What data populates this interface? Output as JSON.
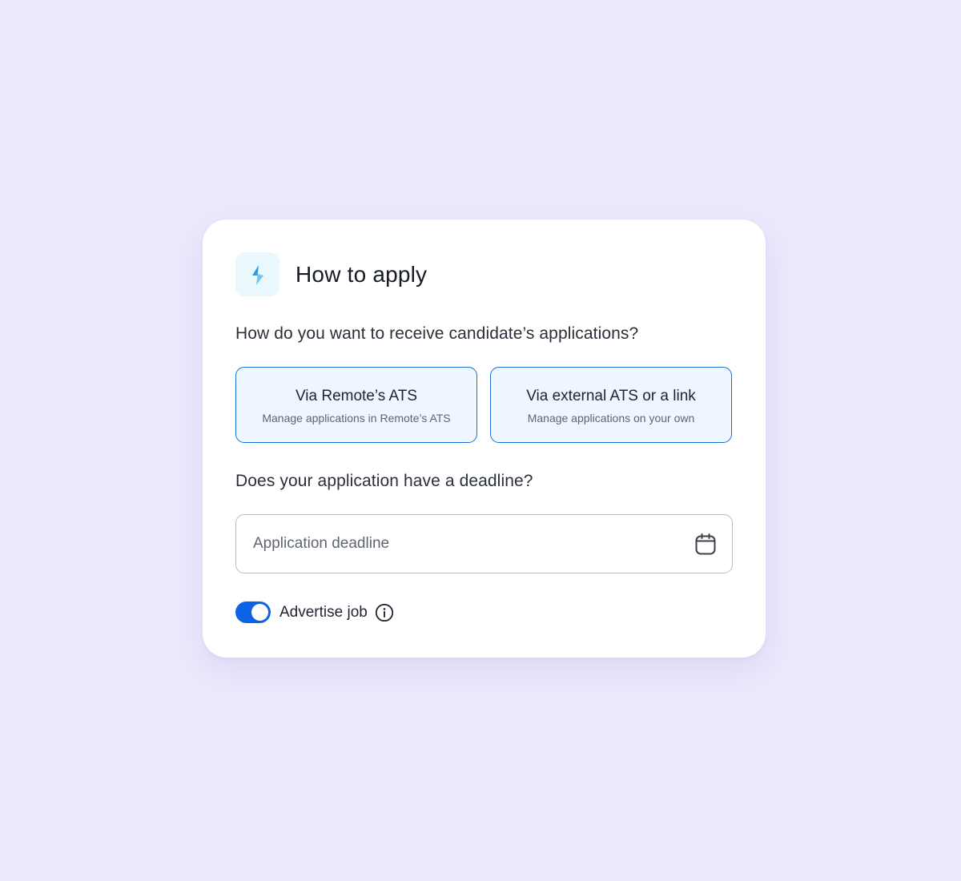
{
  "card": {
    "title": "How to apply",
    "icon": "lightning-bolt-icon"
  },
  "receive": {
    "question": "How do you want to receive candidate’s applications?",
    "options": [
      {
        "title": "Via Remote’s ATS",
        "subtitle": "Manage applications in Remote’s ATS"
      },
      {
        "title": "Via external ATS or a link",
        "subtitle": "Manage applications on your own"
      }
    ]
  },
  "deadline": {
    "question": "Does your application have a deadline?",
    "placeholder": "Application deadline",
    "icon": "calendar-icon"
  },
  "advertise": {
    "label": "Advertise job",
    "enabled": true,
    "icon": "info-icon"
  },
  "colors": {
    "background": "#ede8fd",
    "accent": "#0d63e8",
    "option_border": "#1a6fd0",
    "option_fill": "#eef6ff"
  }
}
